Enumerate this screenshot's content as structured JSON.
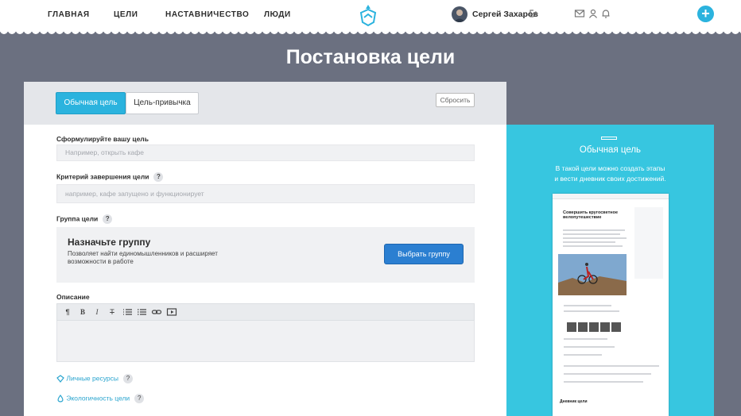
{
  "nav": {
    "items": [
      "ГЛАВНАЯ",
      "ЦЕЛИ",
      "НАСТАВНИЧЕСТВО",
      "ЛЮДИ"
    ],
    "user_name": "Сергей Захаров",
    "add_label": "+"
  },
  "page": {
    "title": "Постановка цели"
  },
  "tabs": {
    "regular": "Обычная цель",
    "habit": "Цель-привычка",
    "reset": "Сбросить"
  },
  "form": {
    "goal_label": "Сформулируйте вашу цель",
    "goal_placeholder": "Например, открыть кафе",
    "criteria_label": "Критерий завершения цели",
    "criteria_placeholder": "например, кафе запущено и функционирует",
    "group_label": "Группа цели",
    "group_box_title": "Назначьте группу",
    "group_box_desc": "Позволяет найти единомышленников и расширяет возможности в работе",
    "group_button": "Выбрать группу",
    "description_label": "Описание",
    "help": "?",
    "personal_resources": "Личные ресурсы",
    "eco": "Экологичность цели"
  },
  "editor_toolbar": [
    "¶",
    "B",
    "I",
    "T",
    "list",
    "numbered-list",
    "link",
    "video"
  ],
  "promo": {
    "title": "Обычная цель",
    "desc_line1": "В такой цели можно создать этапы",
    "desc_line2": "и вести дневник своих достижений."
  },
  "preview": {
    "goal_title": "Совершить кругосветное велопутешествие",
    "diary": "Дневник цели"
  },
  "colors": {
    "accent": "#2bb3de",
    "promo": "#37c6e0",
    "button": "#2b7fd1",
    "background": "#6b7080"
  }
}
